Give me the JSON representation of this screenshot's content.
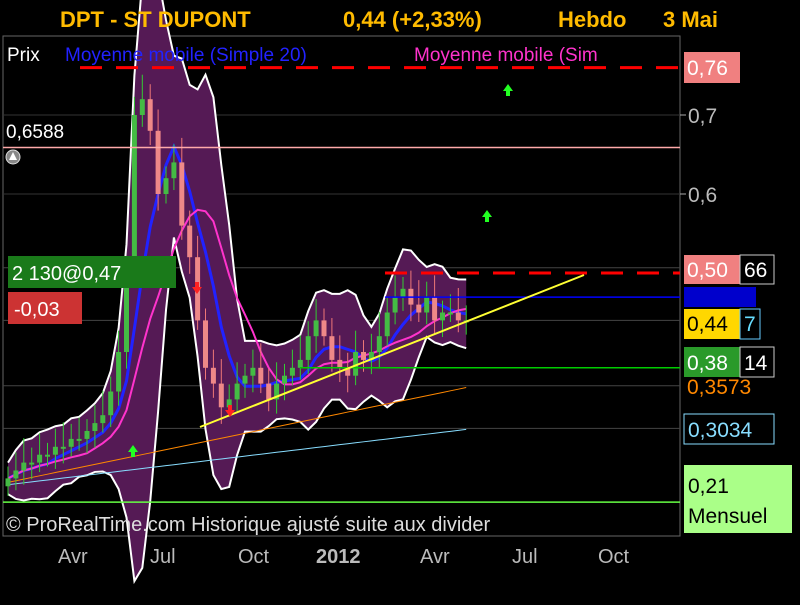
{
  "header": {
    "symbol": "DPT - ST DUPONT",
    "quote": "0,44 (+2,33%)",
    "period": "Hebdo",
    "date": "3 Mai"
  },
  "legend": {
    "price_label": "Prix",
    "ma20_label": "Moyenne mobile (Simple 20)",
    "ma_other_label": "Moyenne mobile (Sim"
  },
  "overlays": {
    "level_label": "0,6588",
    "order_main": "2 130@0,47",
    "order_delta": "-0,03",
    "copyright": "© ProRealTime.com Historique ajusté suite aux divider"
  },
  "axis": {
    "y_ticks": [
      "0,7",
      "0,6"
    ],
    "x_ticks": [
      "Avr",
      "Jul",
      "Oct",
      "2012",
      "Avr",
      "Jul",
      "Oct"
    ]
  },
  "price_tags": [
    {
      "text": "0,76",
      "color": "#f08080"
    },
    {
      "text": "0,50",
      "color": "#f08080"
    },
    {
      "text": "66",
      "color": "#000000"
    },
    {
      "text": "0,44",
      "color": "#ffd700"
    },
    {
      "text": "7",
      "color": "#000000"
    },
    {
      "text": "0,38",
      "color": "#2a9a2a"
    },
    {
      "text": "14",
      "color": "#000000"
    },
    {
      "text": "0,3573",
      "color": "#000000"
    },
    {
      "text": "0,3034",
      "color": "#000000"
    },
    {
      "text": "0,21",
      "color": "#aaff88"
    },
    {
      "text": "Mensuel",
      "color": "#aaff88"
    }
  ],
  "chart_data": {
    "type": "candlestick",
    "title": "DPT - ST DUPONT",
    "period": "Hebdo",
    "x_ticks": [
      "Avr",
      "Jul",
      "Oct",
      "2012",
      "Avr",
      "Jul",
      "Oct"
    ],
    "ylim": [
      0.23,
      0.78
    ],
    "y_ticks": [
      0.6,
      0.7
    ],
    "closes": [
      0.24,
      0.25,
      0.26,
      0.26,
      0.27,
      0.27,
      0.28,
      0.28,
      0.29,
      0.29,
      0.3,
      0.31,
      0.32,
      0.35,
      0.4,
      0.5,
      0.7,
      0.72,
      0.68,
      0.6,
      0.62,
      0.64,
      0.56,
      0.52,
      0.44,
      0.38,
      0.36,
      0.33,
      0.34,
      0.36,
      0.37,
      0.38,
      0.36,
      0.34,
      0.36,
      0.37,
      0.38,
      0.39,
      0.42,
      0.44,
      0.42,
      0.39,
      0.38,
      0.37,
      0.4,
      0.39,
      0.4,
      0.42,
      0.45,
      0.47,
      0.48,
      0.46,
      0.45,
      0.47,
      0.44,
      0.45,
      0.45,
      0.44,
      0.44
    ],
    "levels": [
      {
        "name": "resistance-high",
        "value": 0.76,
        "style": "dashed",
        "color": "#ff0000"
      },
      {
        "name": "level-0.6588",
        "value": 0.6588,
        "style": "solid",
        "color": "#ffaaaa"
      },
      {
        "name": "resistance",
        "value": 0.5,
        "style": "dashed",
        "color": "#ff0000"
      },
      {
        "name": "blue-level",
        "value": 0.4695,
        "style": "solid",
        "color": "#0000ff"
      },
      {
        "name": "support",
        "value": 0.38,
        "style": "solid",
        "color": "#00cc00"
      },
      {
        "name": "monthly",
        "value": 0.21,
        "style": "solid",
        "color": "#66ff44"
      }
    ],
    "indicators": [
      {
        "name": "Moyenne mobile (Simple 20)",
        "color": "#2222ff"
      },
      {
        "name": "Moyenne mobile (Sim",
        "color": "#ff33cc"
      }
    ],
    "price_labels": [
      0.76,
      0.5066,
      0.4695,
      0.44,
      0.3814,
      0.3573,
      0.3034,
      0.21
    ]
  }
}
